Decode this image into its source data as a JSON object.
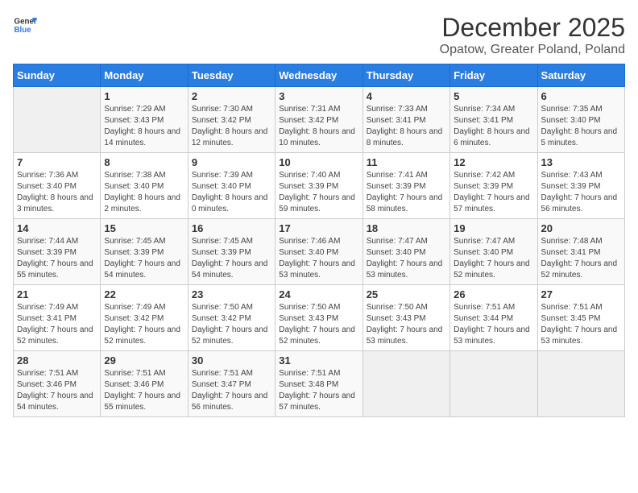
{
  "header": {
    "logo_general": "General",
    "logo_blue": "Blue",
    "month": "December 2025",
    "location": "Opatow, Greater Poland, Poland"
  },
  "days_of_week": [
    "Sunday",
    "Monday",
    "Tuesday",
    "Wednesday",
    "Thursday",
    "Friday",
    "Saturday"
  ],
  "weeks": [
    [
      {
        "day": "",
        "empty": true
      },
      {
        "day": "1",
        "sunrise": "Sunrise: 7:29 AM",
        "sunset": "Sunset: 3:43 PM",
        "daylight": "Daylight: 8 hours and 14 minutes."
      },
      {
        "day": "2",
        "sunrise": "Sunrise: 7:30 AM",
        "sunset": "Sunset: 3:42 PM",
        "daylight": "Daylight: 8 hours and 12 minutes."
      },
      {
        "day": "3",
        "sunrise": "Sunrise: 7:31 AM",
        "sunset": "Sunset: 3:42 PM",
        "daylight": "Daylight: 8 hours and 10 minutes."
      },
      {
        "day": "4",
        "sunrise": "Sunrise: 7:33 AM",
        "sunset": "Sunset: 3:41 PM",
        "daylight": "Daylight: 8 hours and 8 minutes."
      },
      {
        "day": "5",
        "sunrise": "Sunrise: 7:34 AM",
        "sunset": "Sunset: 3:41 PM",
        "daylight": "Daylight: 8 hours and 6 minutes."
      },
      {
        "day": "6",
        "sunrise": "Sunrise: 7:35 AM",
        "sunset": "Sunset: 3:40 PM",
        "daylight": "Daylight: 8 hours and 5 minutes."
      }
    ],
    [
      {
        "day": "7",
        "sunrise": "Sunrise: 7:36 AM",
        "sunset": "Sunset: 3:40 PM",
        "daylight": "Daylight: 8 hours and 3 minutes."
      },
      {
        "day": "8",
        "sunrise": "Sunrise: 7:38 AM",
        "sunset": "Sunset: 3:40 PM",
        "daylight": "Daylight: 8 hours and 2 minutes."
      },
      {
        "day": "9",
        "sunrise": "Sunrise: 7:39 AM",
        "sunset": "Sunset: 3:40 PM",
        "daylight": "Daylight: 8 hours and 0 minutes."
      },
      {
        "day": "10",
        "sunrise": "Sunrise: 7:40 AM",
        "sunset": "Sunset: 3:39 PM",
        "daylight": "Daylight: 7 hours and 59 minutes."
      },
      {
        "day": "11",
        "sunrise": "Sunrise: 7:41 AM",
        "sunset": "Sunset: 3:39 PM",
        "daylight": "Daylight: 7 hours and 58 minutes."
      },
      {
        "day": "12",
        "sunrise": "Sunrise: 7:42 AM",
        "sunset": "Sunset: 3:39 PM",
        "daylight": "Daylight: 7 hours and 57 minutes."
      },
      {
        "day": "13",
        "sunrise": "Sunrise: 7:43 AM",
        "sunset": "Sunset: 3:39 PM",
        "daylight": "Daylight: 7 hours and 56 minutes."
      }
    ],
    [
      {
        "day": "14",
        "sunrise": "Sunrise: 7:44 AM",
        "sunset": "Sunset: 3:39 PM",
        "daylight": "Daylight: 7 hours and 55 minutes."
      },
      {
        "day": "15",
        "sunrise": "Sunrise: 7:45 AM",
        "sunset": "Sunset: 3:39 PM",
        "daylight": "Daylight: 7 hours and 54 minutes."
      },
      {
        "day": "16",
        "sunrise": "Sunrise: 7:45 AM",
        "sunset": "Sunset: 3:39 PM",
        "daylight": "Daylight: 7 hours and 54 minutes."
      },
      {
        "day": "17",
        "sunrise": "Sunrise: 7:46 AM",
        "sunset": "Sunset: 3:40 PM",
        "daylight": "Daylight: 7 hours and 53 minutes."
      },
      {
        "day": "18",
        "sunrise": "Sunrise: 7:47 AM",
        "sunset": "Sunset: 3:40 PM",
        "daylight": "Daylight: 7 hours and 53 minutes."
      },
      {
        "day": "19",
        "sunrise": "Sunrise: 7:47 AM",
        "sunset": "Sunset: 3:40 PM",
        "daylight": "Daylight: 7 hours and 52 minutes."
      },
      {
        "day": "20",
        "sunrise": "Sunrise: 7:48 AM",
        "sunset": "Sunset: 3:41 PM",
        "daylight": "Daylight: 7 hours and 52 minutes."
      }
    ],
    [
      {
        "day": "21",
        "sunrise": "Sunrise: 7:49 AM",
        "sunset": "Sunset: 3:41 PM",
        "daylight": "Daylight: 7 hours and 52 minutes."
      },
      {
        "day": "22",
        "sunrise": "Sunrise: 7:49 AM",
        "sunset": "Sunset: 3:42 PM",
        "daylight": "Daylight: 7 hours and 52 minutes."
      },
      {
        "day": "23",
        "sunrise": "Sunrise: 7:50 AM",
        "sunset": "Sunset: 3:42 PM",
        "daylight": "Daylight: 7 hours and 52 minutes."
      },
      {
        "day": "24",
        "sunrise": "Sunrise: 7:50 AM",
        "sunset": "Sunset: 3:43 PM",
        "daylight": "Daylight: 7 hours and 52 minutes."
      },
      {
        "day": "25",
        "sunrise": "Sunrise: 7:50 AM",
        "sunset": "Sunset: 3:43 PM",
        "daylight": "Daylight: 7 hours and 53 minutes."
      },
      {
        "day": "26",
        "sunrise": "Sunrise: 7:51 AM",
        "sunset": "Sunset: 3:44 PM",
        "daylight": "Daylight: 7 hours and 53 minutes."
      },
      {
        "day": "27",
        "sunrise": "Sunrise: 7:51 AM",
        "sunset": "Sunset: 3:45 PM",
        "daylight": "Daylight: 7 hours and 53 minutes."
      }
    ],
    [
      {
        "day": "28",
        "sunrise": "Sunrise: 7:51 AM",
        "sunset": "Sunset: 3:46 PM",
        "daylight": "Daylight: 7 hours and 54 minutes."
      },
      {
        "day": "29",
        "sunrise": "Sunrise: 7:51 AM",
        "sunset": "Sunset: 3:46 PM",
        "daylight": "Daylight: 7 hours and 55 minutes."
      },
      {
        "day": "30",
        "sunrise": "Sunrise: 7:51 AM",
        "sunset": "Sunset: 3:47 PM",
        "daylight": "Daylight: 7 hours and 56 minutes."
      },
      {
        "day": "31",
        "sunrise": "Sunrise: 7:51 AM",
        "sunset": "Sunset: 3:48 PM",
        "daylight": "Daylight: 7 hours and 57 minutes."
      },
      {
        "day": "",
        "empty": true
      },
      {
        "day": "",
        "empty": true
      },
      {
        "day": "",
        "empty": true
      }
    ]
  ]
}
